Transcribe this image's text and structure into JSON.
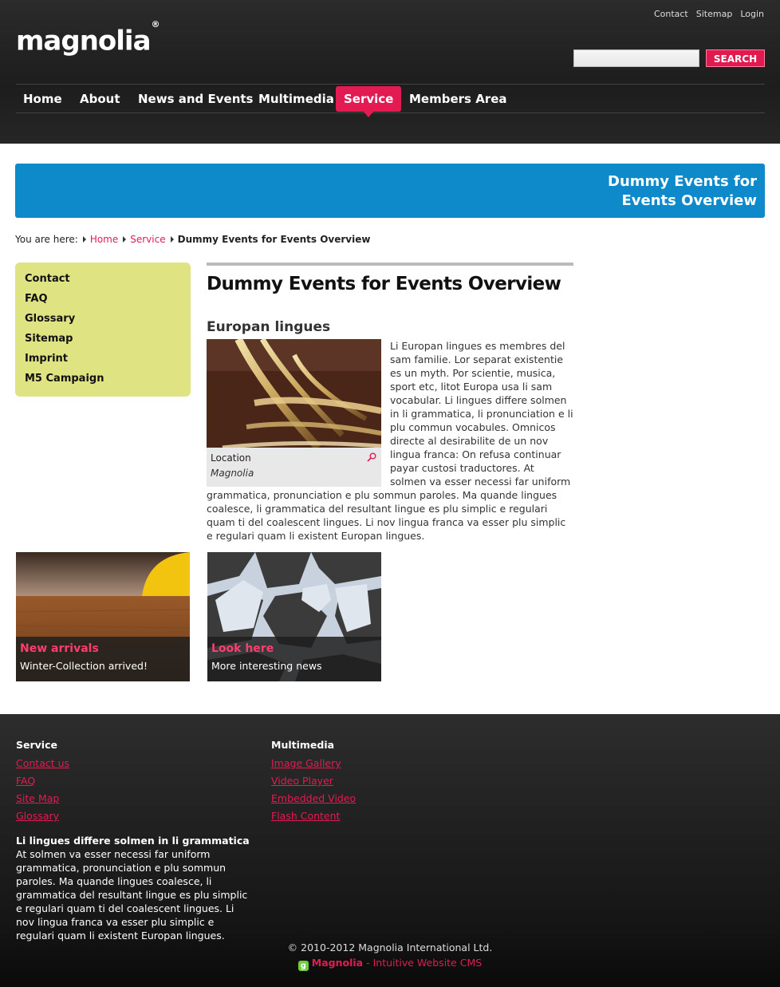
{
  "header": {
    "logo_text": "magnolia",
    "logo_mark": "®",
    "metanav": [
      "Contact",
      "Sitemap",
      "Login"
    ],
    "search": {
      "placeholder": "",
      "button_label": "SEARCH"
    },
    "nav": [
      "Home",
      "About",
      "News and Events",
      "Multimedia",
      "Service",
      "Members Area"
    ],
    "active_nav": "Service"
  },
  "banner": {
    "title": "Dummy Events for Events Overview"
  },
  "breadcrumb": {
    "prefix": "You are here:",
    "items": [
      "Home",
      "Service"
    ],
    "current": "Dummy Events for Events Overview"
  },
  "subnav": [
    "Contact",
    "FAQ",
    "Glossary",
    "Sitemap",
    "Imprint",
    "M5 Campaign"
  ],
  "main": {
    "title": "Dummy Events for Events Overview",
    "section_title": "Europan lingues",
    "figure": {
      "caption": "Location",
      "credit": "Magnolia",
      "icon": "zoom-icon"
    },
    "body": "Li Europan lingues es membres del sam familie. Lor separat existentie es un myth. Por scientie, musica, sport etc, litot Europa usa li sam vocabular. Li lingues differe solmen in li grammatica, li pronunciation e li plu commun vocabules. Omnicos directe al desirabilite de un nov lingua franca: On refusa continuar payar custosi traductores. At solmen va esser necessi far uniform grammatica, pronunciation e plu sommun paroles. Ma quande lingues coalesce, li grammatica del resultant lingue es plu simplic e regulari quam ti del coalescent lingues. Li nov lingua franca va esser plu simplic e regulari quam li existent Europan lingues."
  },
  "teasers": [
    {
      "title": "New arrivals",
      "text": "Winter-Collection arrived!"
    },
    {
      "title": "Look here",
      "text": "More interesting news"
    }
  ],
  "footer": {
    "columns": [
      {
        "heading": "Service",
        "links": [
          "Contact us",
          "FAQ",
          "Site Map",
          "Glossary"
        ]
      },
      {
        "heading": "Multimedia",
        "links": [
          "Image Gallery",
          "Video Player",
          "Embedded Video",
          "Flash Content"
        ]
      }
    ],
    "about_title": "Li lingues differe solmen in li grammatica",
    "about_text": "At solmen va esser necessi far uniform grammatica, pronunciation e plu sommun paroles. Ma quande lingues coalesce, li grammatica del resultant lingue es plu simplic e regulari quam ti del coalescent lingues. Li nov lingua franca va esser plu simplic e regulari quam li existent Europan lingues.",
    "copyright": "© 2010-2012 Magnolia International Ltd.",
    "powered_brand": "Magnolia",
    "powered_tagline": " - Intuitive Website CMS"
  },
  "colors": {
    "accent": "#e21c53",
    "banner": "#0e8acb",
    "subnav": "#e0e381"
  }
}
